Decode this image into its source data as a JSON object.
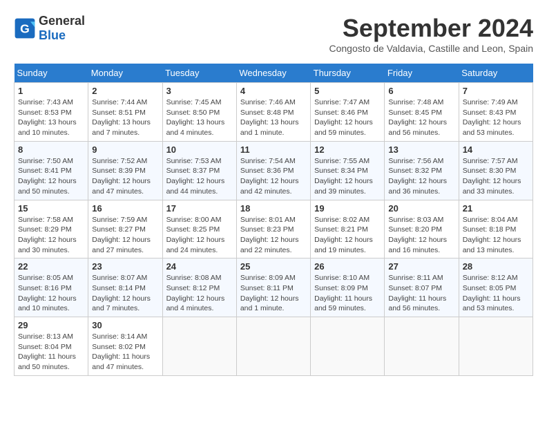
{
  "header": {
    "logo_general": "General",
    "logo_blue": "Blue",
    "month_title": "September 2024",
    "subtitle": "Congosto de Valdavia, Castille and Leon, Spain"
  },
  "weekdays": [
    "Sunday",
    "Monday",
    "Tuesday",
    "Wednesday",
    "Thursday",
    "Friday",
    "Saturday"
  ],
  "weeks": [
    [
      {
        "day": "1",
        "detail": "Sunrise: 7:43 AM\nSunset: 8:53 PM\nDaylight: 13 hours and 10 minutes."
      },
      {
        "day": "2",
        "detail": "Sunrise: 7:44 AM\nSunset: 8:51 PM\nDaylight: 13 hours and 7 minutes."
      },
      {
        "day": "3",
        "detail": "Sunrise: 7:45 AM\nSunset: 8:50 PM\nDaylight: 13 hours and 4 minutes."
      },
      {
        "day": "4",
        "detail": "Sunrise: 7:46 AM\nSunset: 8:48 PM\nDaylight: 13 hours and 1 minute."
      },
      {
        "day": "5",
        "detail": "Sunrise: 7:47 AM\nSunset: 8:46 PM\nDaylight: 12 hours and 59 minutes."
      },
      {
        "day": "6",
        "detail": "Sunrise: 7:48 AM\nSunset: 8:45 PM\nDaylight: 12 hours and 56 minutes."
      },
      {
        "day": "7",
        "detail": "Sunrise: 7:49 AM\nSunset: 8:43 PM\nDaylight: 12 hours and 53 minutes."
      }
    ],
    [
      {
        "day": "8",
        "detail": "Sunrise: 7:50 AM\nSunset: 8:41 PM\nDaylight: 12 hours and 50 minutes."
      },
      {
        "day": "9",
        "detail": "Sunrise: 7:52 AM\nSunset: 8:39 PM\nDaylight: 12 hours and 47 minutes."
      },
      {
        "day": "10",
        "detail": "Sunrise: 7:53 AM\nSunset: 8:37 PM\nDaylight: 12 hours and 44 minutes."
      },
      {
        "day": "11",
        "detail": "Sunrise: 7:54 AM\nSunset: 8:36 PM\nDaylight: 12 hours and 42 minutes."
      },
      {
        "day": "12",
        "detail": "Sunrise: 7:55 AM\nSunset: 8:34 PM\nDaylight: 12 hours and 39 minutes."
      },
      {
        "day": "13",
        "detail": "Sunrise: 7:56 AM\nSunset: 8:32 PM\nDaylight: 12 hours and 36 minutes."
      },
      {
        "day": "14",
        "detail": "Sunrise: 7:57 AM\nSunset: 8:30 PM\nDaylight: 12 hours and 33 minutes."
      }
    ],
    [
      {
        "day": "15",
        "detail": "Sunrise: 7:58 AM\nSunset: 8:29 PM\nDaylight: 12 hours and 30 minutes."
      },
      {
        "day": "16",
        "detail": "Sunrise: 7:59 AM\nSunset: 8:27 PM\nDaylight: 12 hours and 27 minutes."
      },
      {
        "day": "17",
        "detail": "Sunrise: 8:00 AM\nSunset: 8:25 PM\nDaylight: 12 hours and 24 minutes."
      },
      {
        "day": "18",
        "detail": "Sunrise: 8:01 AM\nSunset: 8:23 PM\nDaylight: 12 hours and 22 minutes."
      },
      {
        "day": "19",
        "detail": "Sunrise: 8:02 AM\nSunset: 8:21 PM\nDaylight: 12 hours and 19 minutes."
      },
      {
        "day": "20",
        "detail": "Sunrise: 8:03 AM\nSunset: 8:20 PM\nDaylight: 12 hours and 16 minutes."
      },
      {
        "day": "21",
        "detail": "Sunrise: 8:04 AM\nSunset: 8:18 PM\nDaylight: 12 hours and 13 minutes."
      }
    ],
    [
      {
        "day": "22",
        "detail": "Sunrise: 8:05 AM\nSunset: 8:16 PM\nDaylight: 12 hours and 10 minutes."
      },
      {
        "day": "23",
        "detail": "Sunrise: 8:07 AM\nSunset: 8:14 PM\nDaylight: 12 hours and 7 minutes."
      },
      {
        "day": "24",
        "detail": "Sunrise: 8:08 AM\nSunset: 8:12 PM\nDaylight: 12 hours and 4 minutes."
      },
      {
        "day": "25",
        "detail": "Sunrise: 8:09 AM\nSunset: 8:11 PM\nDaylight: 12 hours and 1 minute."
      },
      {
        "day": "26",
        "detail": "Sunrise: 8:10 AM\nSunset: 8:09 PM\nDaylight: 11 hours and 59 minutes."
      },
      {
        "day": "27",
        "detail": "Sunrise: 8:11 AM\nSunset: 8:07 PM\nDaylight: 11 hours and 56 minutes."
      },
      {
        "day": "28",
        "detail": "Sunrise: 8:12 AM\nSunset: 8:05 PM\nDaylight: 11 hours and 53 minutes."
      }
    ],
    [
      {
        "day": "29",
        "detail": "Sunrise: 8:13 AM\nSunset: 8:04 PM\nDaylight: 11 hours and 50 minutes."
      },
      {
        "day": "30",
        "detail": "Sunrise: 8:14 AM\nSunset: 8:02 PM\nDaylight: 11 hours and 47 minutes."
      },
      {
        "day": "",
        "detail": ""
      },
      {
        "day": "",
        "detail": ""
      },
      {
        "day": "",
        "detail": ""
      },
      {
        "day": "",
        "detail": ""
      },
      {
        "day": "",
        "detail": ""
      }
    ]
  ]
}
